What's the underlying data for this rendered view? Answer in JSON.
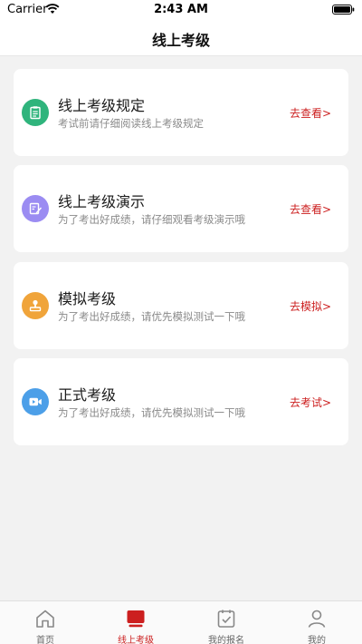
{
  "status_bar": {
    "carrier": "Carrier",
    "time": "2:43 AM"
  },
  "nav": {
    "title": "线上考级"
  },
  "cards": [
    {
      "title": "线上考级规定",
      "desc": "考试前请仔细阅读线上考级规定",
      "action": "去查看>",
      "icon": "document-icon",
      "color": "#2fb47c"
    },
    {
      "title": "线上考级演示",
      "desc": "为了考出好成绩，请仔细观看考级演示哦",
      "action": "去查看>",
      "icon": "edit-icon",
      "color": "#9b8cf2"
    },
    {
      "title": "模拟考级",
      "desc": "为了考出好成绩，请优先模拟测试一下哦",
      "action": "去模拟>",
      "icon": "user-icon",
      "color": "#f0a43a"
    },
    {
      "title": "正式考级",
      "desc": "为了考出好成绩，请优先模拟测试一下哦",
      "action": "去考试>",
      "icon": "video-icon",
      "color": "#4c9fe8"
    }
  ],
  "tabs": [
    {
      "label": "首页",
      "icon": "home-icon",
      "active": false
    },
    {
      "label": "线上考级",
      "icon": "exam-icon",
      "active": true
    },
    {
      "label": "我的报名",
      "icon": "checklist-icon",
      "active": false
    },
    {
      "label": "我的",
      "icon": "profile-icon",
      "active": false
    }
  ],
  "colors": {
    "accent": "#cc1f1f",
    "background": "#f2f2f2"
  }
}
